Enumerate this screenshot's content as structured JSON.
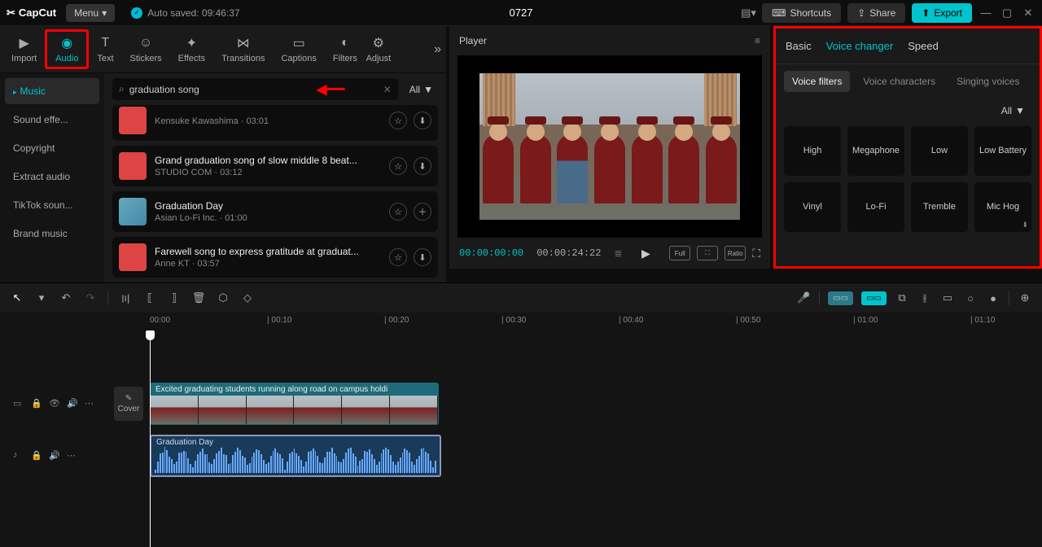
{
  "app": {
    "name": "CapCut",
    "menu": "Menu",
    "autosave": "Auto saved: 09:46:37",
    "project_title": "0727"
  },
  "title_actions": {
    "shortcuts": "Shortcuts",
    "share": "Share",
    "export": "Export"
  },
  "tooltabs": [
    {
      "label": "Import",
      "icon": "import-icon"
    },
    {
      "label": "Audio",
      "icon": "audio-icon",
      "active": true
    },
    {
      "label": "Text",
      "icon": "text-icon"
    },
    {
      "label": "Stickers",
      "icon": "stickers-icon"
    },
    {
      "label": "Effects",
      "icon": "effects-icon"
    },
    {
      "label": "Transitions",
      "icon": "transitions-icon"
    },
    {
      "label": "Captions",
      "icon": "captions-icon"
    },
    {
      "label": "Filters",
      "icon": "filters-icon"
    },
    {
      "label": "Adjust",
      "icon": "adjust-icon"
    }
  ],
  "sidenav": [
    "Music",
    "Sound effe...",
    "Copyright",
    "Extract audio",
    "TikTok soun...",
    "Brand music"
  ],
  "search": {
    "query": "graduation song",
    "all_label": "All"
  },
  "songs": [
    {
      "title": "",
      "artist": "Kensuke Kawashima",
      "duration": "03:01",
      "actions": [
        "star",
        "download"
      ]
    },
    {
      "title": "Grand graduation song of slow middle 8 beat...",
      "artist": "STUDIO COM",
      "duration": "03:12",
      "actions": [
        "star",
        "download"
      ]
    },
    {
      "title": "Graduation Day",
      "artist": "Asian Lo-Fi Inc.",
      "duration": "01:00",
      "thumb": "blue",
      "actions": [
        "star",
        "plus"
      ]
    },
    {
      "title": "Farewell song to express gratitude at graduat...",
      "artist": "Anne KT",
      "duration": "03:57",
      "actions": [
        "star",
        "download"
      ]
    }
  ],
  "player": {
    "label": "Player",
    "current": "00:00:00:00",
    "duration": "00:00:24:22",
    "ctrls": {
      "full": "Full",
      "ratio": "Ratio"
    }
  },
  "rtabs": [
    "Basic",
    "Voice changer",
    "Speed"
  ],
  "subtabs": [
    "Voice filters",
    "Voice characters",
    "Singing voices"
  ],
  "filter_all": "All",
  "voice_filters": [
    "High",
    "Megaphone",
    "Low",
    "Low Battery",
    "Vinyl",
    "Lo-Fi",
    "Tremble",
    "Mic Hog"
  ],
  "ruler": [
    "00:00",
    "| 00:10",
    "| 00:20",
    "| 00:30",
    "| 00:40",
    "| 00:50",
    "| 01:00",
    "| 01:10"
  ],
  "clips": {
    "video_title": "Excited graduating students running along road on campus holdi",
    "audio_title": "Graduation Day",
    "cover": "Cover"
  }
}
